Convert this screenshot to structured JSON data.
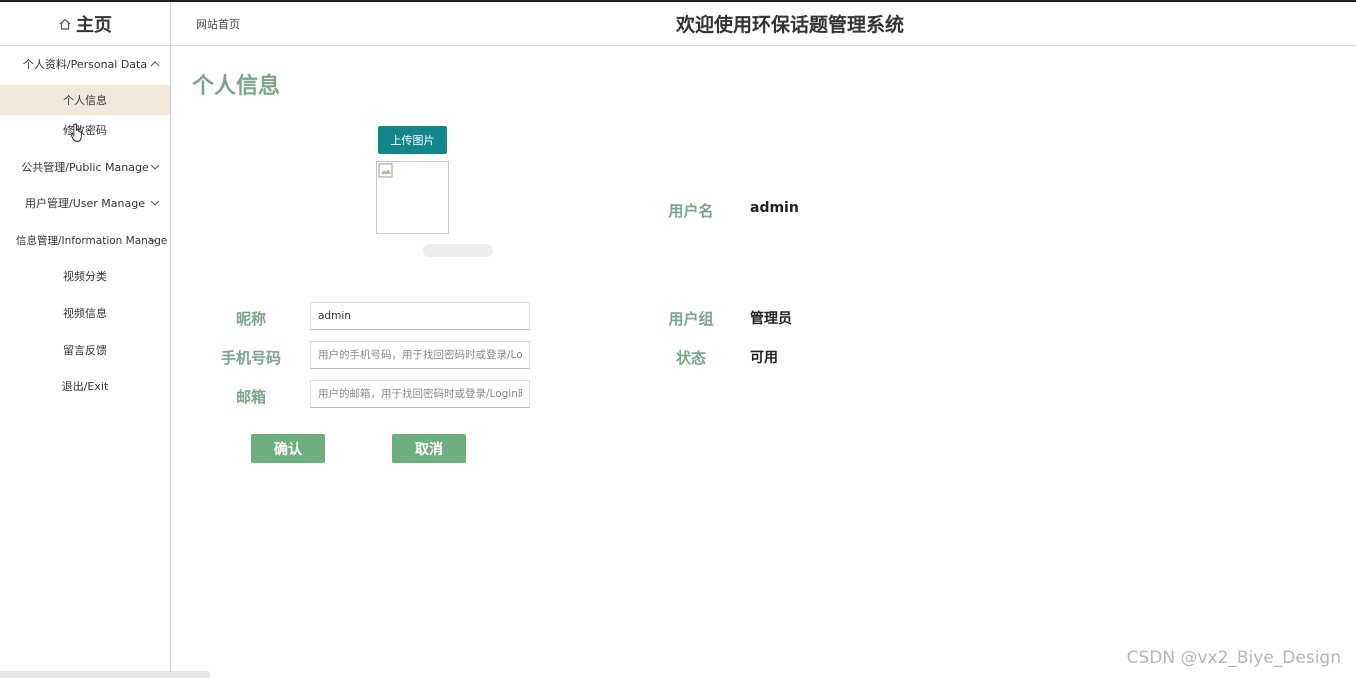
{
  "header": {
    "home_label": "主页",
    "site_link": "网站首页",
    "system_title": "欢迎使用环保话题管理系统"
  },
  "sidebar": {
    "groups": [
      {
        "label": "个人资料/Personal Data",
        "expanded": true
      },
      {
        "label": "公共管理/Public Manage",
        "expanded": false
      },
      {
        "label": "用户管理/User Manage",
        "expanded": false
      },
      {
        "label": "信息管理/Information Manage",
        "expanded": true
      }
    ],
    "items": [
      {
        "label": "个人信息",
        "active": true
      },
      {
        "label": "修改密码",
        "active": false
      },
      {
        "label": "视频分类",
        "active": false
      },
      {
        "label": "视频信息",
        "active": false
      },
      {
        "label": "留言反馈",
        "active": false
      },
      {
        "label": "退出/Exit",
        "active": false
      }
    ]
  },
  "main": {
    "page_title": "个人信息",
    "upload_button": "上传图片",
    "form": {
      "nickname": {
        "label": "昵称",
        "value": "admin"
      },
      "phone": {
        "label": "手机号码",
        "value": "",
        "placeholder": "用户的手机号码，用于找回密码时或登录/Login时"
      },
      "email": {
        "label": "邮箱",
        "value": "",
        "placeholder": "用户的邮箱，用于找回密码时或登录/Login时"
      }
    },
    "info": {
      "username": {
        "label": "用户名",
        "value": "admin"
      },
      "group": {
        "label": "用户组",
        "value": "管理员"
      },
      "status": {
        "label": "状态",
        "value": "可用"
      }
    },
    "confirm_button": "确认",
    "cancel_button": "取消"
  },
  "watermark": "CSDN @vx2_Biye_Design",
  "colors": {
    "accent_green": "#7aa58a",
    "button_green": "#6fae7f",
    "upload_teal": "#12868b",
    "active_menu_bg": "#f1e8d9"
  },
  "icons": [
    "home-icon",
    "chevron-up-icon",
    "chevron-down-icon",
    "broken-image-icon",
    "hand-cursor-icon"
  ]
}
